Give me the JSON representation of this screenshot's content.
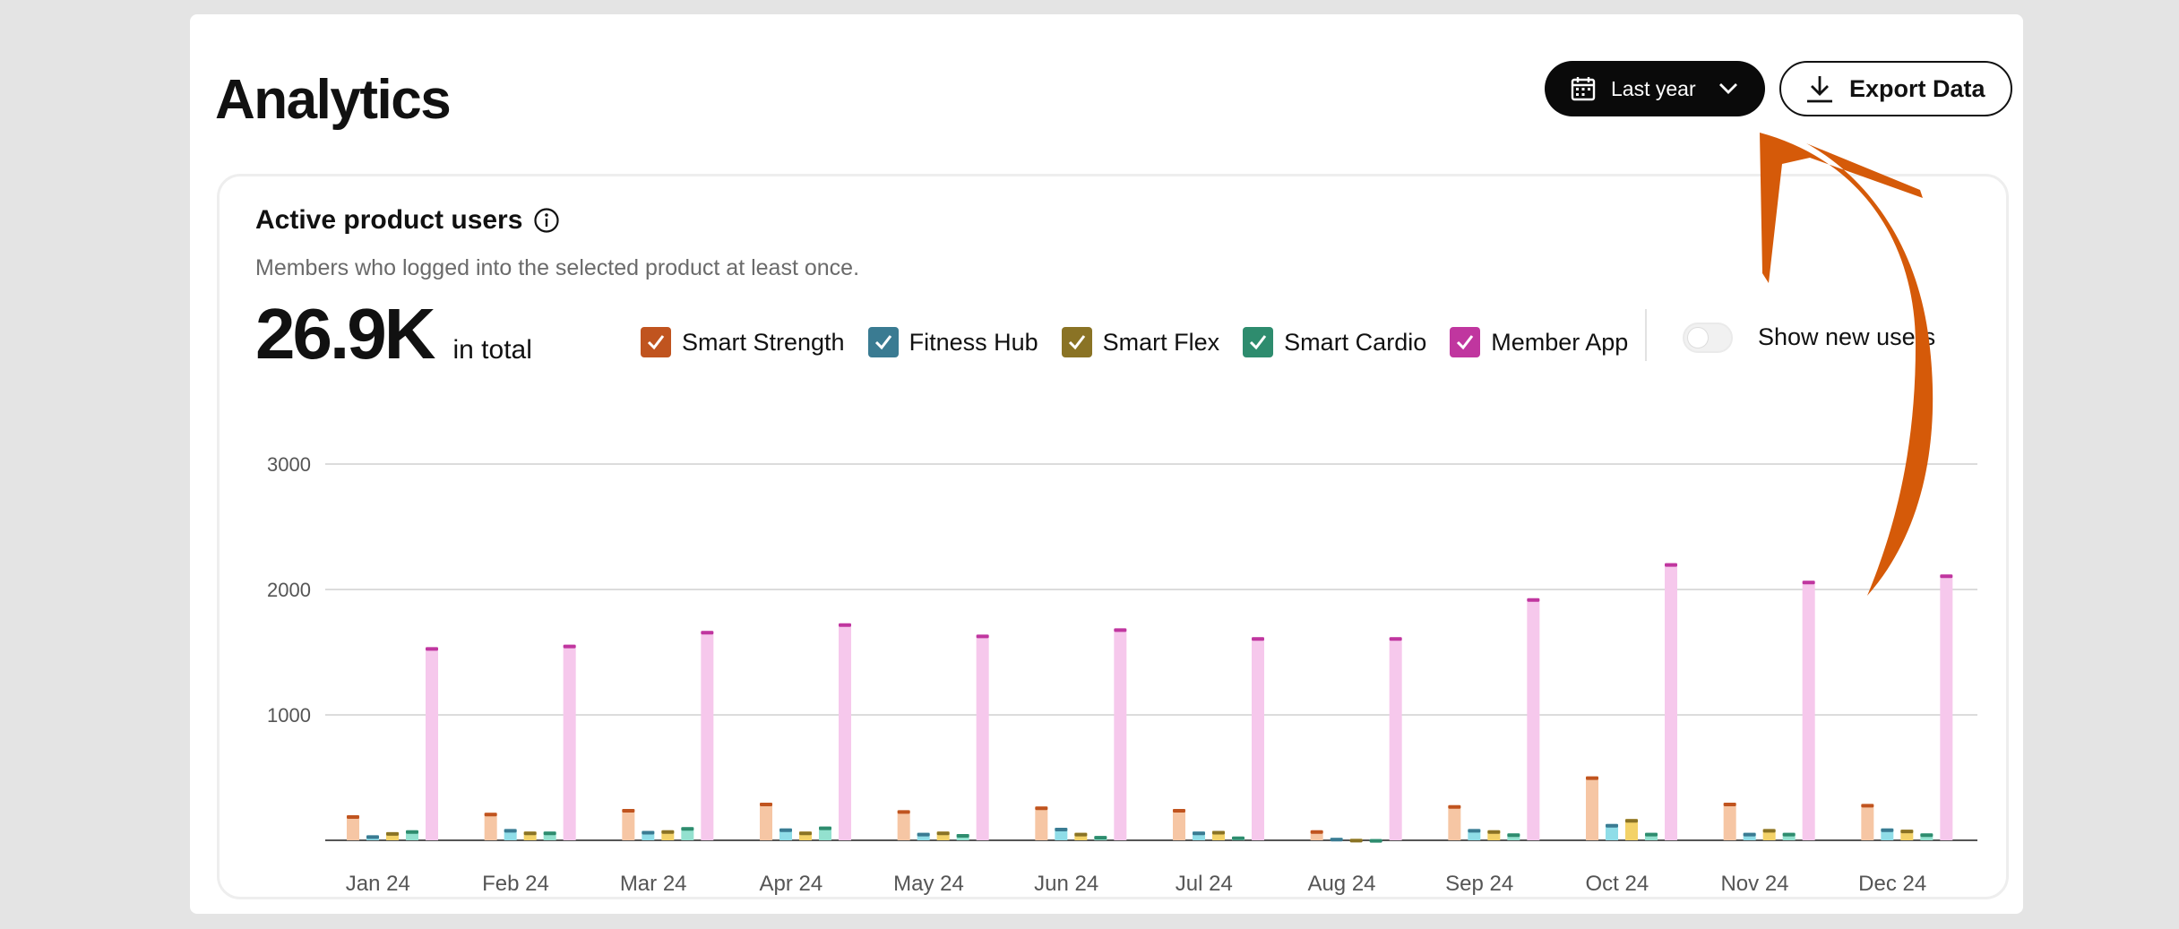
{
  "page": {
    "title": "Analytics"
  },
  "header": {
    "date_range_label": "Last year",
    "export_label": "Export Data",
    "icons": {
      "date_range": "calendar-icon",
      "dropdown": "chevron-down-icon",
      "export": "download-icon"
    }
  },
  "card": {
    "title": "Active product users",
    "subtitle": "Members who logged into the selected product at least once.",
    "total_value": "26.9K",
    "total_unit": "in total",
    "toggle_label": "Show new users",
    "toggle_on": false
  },
  "colors": {
    "accent": "#000000",
    "annotation_arrow": "#d55a09",
    "gridline": "#dcdcdc",
    "axis": "#555555"
  },
  "chart_data": {
    "type": "bar",
    "title": "",
    "xlabel": "",
    "ylabel": "",
    "ylim": [
      0,
      3000
    ],
    "yticks": [
      1000,
      2000,
      3000
    ],
    "grid": true,
    "legend": "top",
    "categories": [
      "Jan 24",
      "Feb 24",
      "Mar 24",
      "Apr 24",
      "May 24",
      "Jun 24",
      "Jul 24",
      "Aug 24",
      "Sep 24",
      "Oct 24",
      "Nov 24",
      "Dec 24"
    ],
    "series": [
      {
        "name": "Smart Strength",
        "checked": true,
        "color": "#c0541f",
        "bar_color": "#f6c6a4",
        "values": [
          200,
          220,
          250,
          300,
          240,
          270,
          250,
          80,
          280,
          510,
          300,
          290
        ]
      },
      {
        "name": "Fitness Hub",
        "checked": true,
        "color": "#3a7b92",
        "bar_color": "#8fdde8",
        "values": [
          40,
          90,
          75,
          95,
          60,
          100,
          70,
          20,
          90,
          130,
          60,
          95
        ]
      },
      {
        "name": "Smart Flex",
        "checked": true,
        "color": "#8a7325",
        "bar_color": "#f3d268",
        "values": [
          65,
          70,
          80,
          70,
          70,
          60,
          75,
          12,
          80,
          170,
          90,
          85
        ]
      },
      {
        "name": "Smart Cardio",
        "checked": true,
        "color": "#2e8c6e",
        "bar_color": "#93e1cf",
        "values": [
          80,
          70,
          105,
          110,
          50,
          35,
          30,
          10,
          55,
          60,
          60,
          55
        ]
      },
      {
        "name": "Member App",
        "checked": true,
        "color": "#c0369f",
        "bar_color": "#f6c8ec",
        "values": [
          1540,
          1560,
          1670,
          1730,
          1640,
          1690,
          1620,
          1620,
          1930,
          2210,
          2070,
          2120
        ]
      }
    ]
  }
}
